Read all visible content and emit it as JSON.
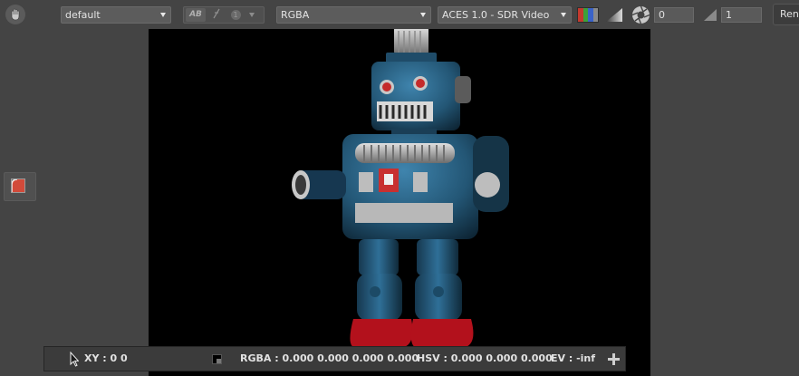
{
  "toolbar": {
    "hand_icon": "hand-icon",
    "preset": {
      "value": "default"
    },
    "ab": {
      "ab_label": "AB",
      "wipe_icon": "wipe-icon",
      "channel_label": "1"
    },
    "channels": {
      "value": "RGBA"
    },
    "display": {
      "value": "ACES 1.0 - SDR Video"
    },
    "channel_swatch_colors": [
      "#c43a2e",
      "#3da13a",
      "#3a63c9",
      "#8a8a8a"
    ],
    "exposure": {
      "value": "0"
    },
    "gamma": {
      "value": "1"
    },
    "render_label": "Render"
  },
  "side_tool_icon": "region-icon",
  "viewer": {
    "image": "toy-robot-render"
  },
  "status": {
    "xy": "XY : 0 0",
    "rgba": "RGBA : 0.000 0.000 0.000 0.000",
    "hsv": "HSV : 0.000 0.000 0.000",
    "ev": "EV : -inf"
  }
}
